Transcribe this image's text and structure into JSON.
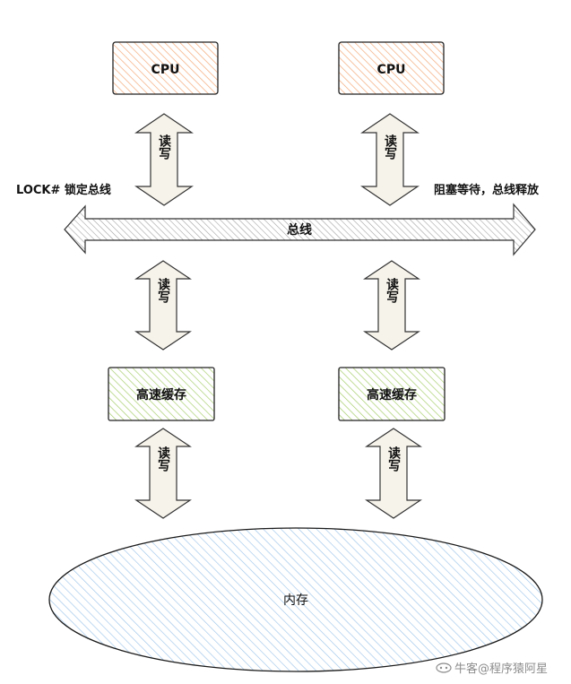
{
  "cpus": [
    {
      "label": "CPU",
      "color": "#f6c49d",
      "stroke": "#222222"
    },
    {
      "label": "CPU",
      "color": "#f6c49d",
      "stroke": "#222222"
    }
  ],
  "caches": [
    {
      "label": "高速缓存",
      "color": "#c4df9b",
      "stroke": "#222222"
    },
    {
      "label": "高速缓存",
      "color": "#c4df9b",
      "stroke": "#222222"
    }
  ],
  "arrow_label": "读写",
  "arrow_fill": "#f6f3ea",
  "bus": {
    "label": "总线",
    "fill": "#c6c6c6",
    "left_annotation": "LOCK# 锁定总线",
    "right_annotation": "阻塞等待，总线释放"
  },
  "memory": {
    "label": "内存",
    "color": "#b9d6ef",
    "stroke": "#1a1a1a"
  },
  "watermark": {
    "text": "牛客@程序猿阿星",
    "color": "#8c8c8c"
  }
}
